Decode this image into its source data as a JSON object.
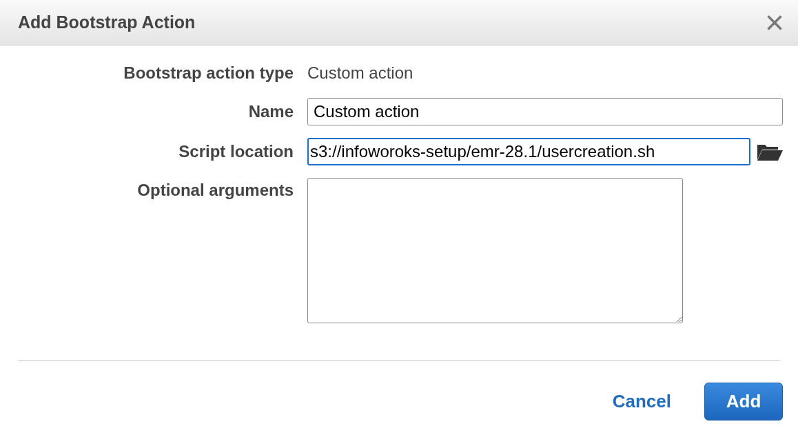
{
  "dialog": {
    "title": "Add Bootstrap Action",
    "close": "×"
  },
  "fields": [
    {
      "kind": "text",
      "label": "Bootstrap action type",
      "value": "Custom action"
    },
    {
      "kind": "input",
      "label": "Name",
      "value": "Custom action",
      "focused": false
    },
    {
      "kind": "browse",
      "label": "Script location",
      "value": "s3://infoworoks-setup/emr-28.1/usercreation.sh",
      "focused": true
    },
    {
      "kind": "textarea",
      "label": "Optional arguments",
      "focused": false
    }
  ],
  "buttons": [
    {
      "kind": "link",
      "label": "Cancel"
    },
    {
      "kind": "primary",
      "label": "Add"
    }
  ]
}
